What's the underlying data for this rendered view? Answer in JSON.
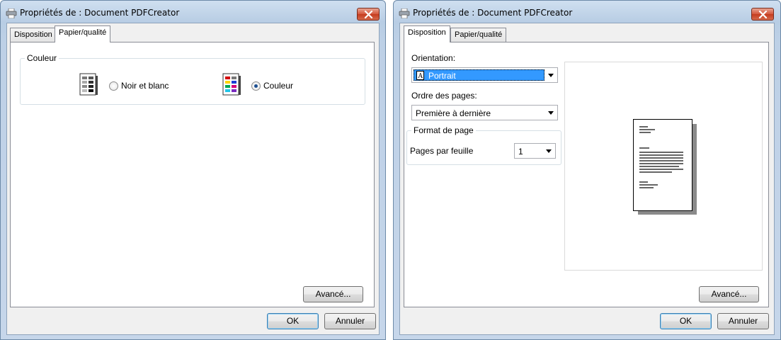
{
  "left_dialog": {
    "title": "Propriétés de : Document PDFCreator",
    "tabs": [
      {
        "label": "Disposition",
        "active": false
      },
      {
        "label": "Papier/qualité",
        "active": true
      }
    ],
    "color_group": {
      "label": "Couleur",
      "options": [
        {
          "label": "Noir et blanc",
          "selected": false,
          "icon": "grayscale-palette-icon"
        },
        {
          "label": "Couleur",
          "selected": true,
          "icon": "color-palette-icon"
        }
      ]
    },
    "advanced_button": "Avancé...",
    "ok_button": "OK",
    "cancel_button": "Annuler"
  },
  "right_dialog": {
    "title": "Propriétés de : Document PDFCreator",
    "tabs": [
      {
        "label": "Disposition",
        "active": true
      },
      {
        "label": "Papier/qualité",
        "active": false
      }
    ],
    "orientation": {
      "label": "Orientation:",
      "value": "Portrait",
      "icon": "portrait-page-icon"
    },
    "page_order": {
      "label": "Ordre des pages:",
      "value": "Première à dernière"
    },
    "page_format": {
      "group_label": "Format de page",
      "pages_per_sheet_label": "Pages par feuille",
      "pages_per_sheet_value": "1"
    },
    "preview": {
      "icon": "page-preview-icon"
    },
    "advanced_button": "Avancé...",
    "ok_button": "OK",
    "cancel_button": "Annuler"
  },
  "colors": {
    "selection": "#3399ff",
    "close_button": "#c43b1e",
    "window_frame": "#bdd0e6"
  }
}
